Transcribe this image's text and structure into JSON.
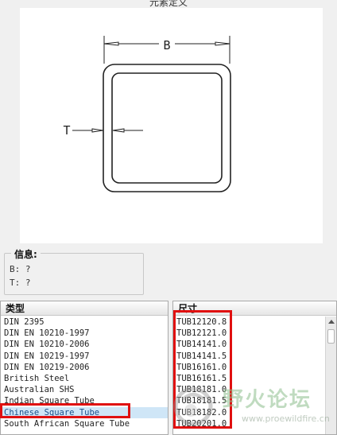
{
  "window": {
    "title": "元素定义"
  },
  "preview": {
    "dimension_b_label": "B",
    "dimension_t_label": "T"
  },
  "info": {
    "legend": "信息:",
    "b_row": "B: ?",
    "t_row": "T: ?"
  },
  "type_list": {
    "header": "类型",
    "items": [
      "DIN 2395",
      "DIN EN 10210-1997",
      "DIN EN 10210-2006",
      "DIN EN 10219-1997",
      "DIN EN 10219-2006",
      "British Steel",
      "Australian SHS",
      "Indian Square Tube",
      "Chinese Square Tube",
      "South African Square Tube"
    ],
    "selected_index": 8
  },
  "size_list": {
    "header": "尺寸",
    "items": [
      "TUB12120.8",
      "TUB12121.0",
      "TUB14141.0",
      "TUB14141.5",
      "TUB16161.0",
      "TUB16161.5",
      "TUB18181.0",
      "TUB18181.5",
      "TUB18182.0",
      "TUB20201.0"
    ]
  },
  "watermark": {
    "text": "野火论坛",
    "url": "www.proewildfire.cn"
  },
  "colors": {
    "highlight_box": "#e01010",
    "selection_bg": "#cfe6f7"
  }
}
